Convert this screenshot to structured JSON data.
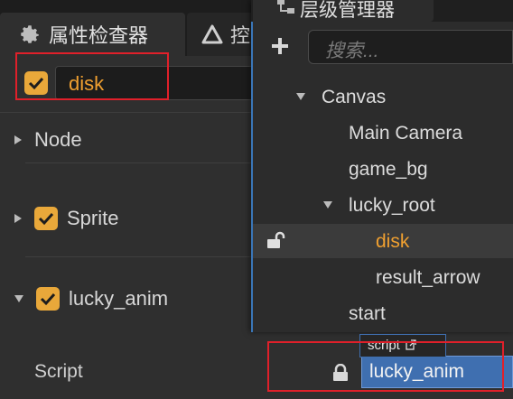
{
  "inspector": {
    "tab_label": "属性检查器",
    "second_tab_label": "控",
    "node_name": "disk",
    "sections": {
      "node": "Node",
      "sprite": "Sprite",
      "lucky_anim": "lucky_anim"
    },
    "script_label": "Script",
    "script_value": "lucky_anim",
    "script_tooltip": "script"
  },
  "hierarchy": {
    "tab_label": "层级管理器",
    "search_placeholder": "搜索...",
    "nodes": [
      "Canvas",
      "Main Camera",
      "game_bg",
      "lucky_root",
      "disk",
      "result_arrow",
      "start"
    ],
    "selected": "disk"
  },
  "colors": {
    "accent_orange": "#f0a030",
    "checkbox_orange": "#e9a83a",
    "highlight_red": "#e0202a",
    "field_blue": "#3f6fb0"
  },
  "icons": [
    "gear-icon",
    "triangle-icon",
    "hierarchy-icon",
    "plus-icon",
    "unlock-icon",
    "lock-icon",
    "external-link-icon",
    "checkmark-icon"
  ]
}
